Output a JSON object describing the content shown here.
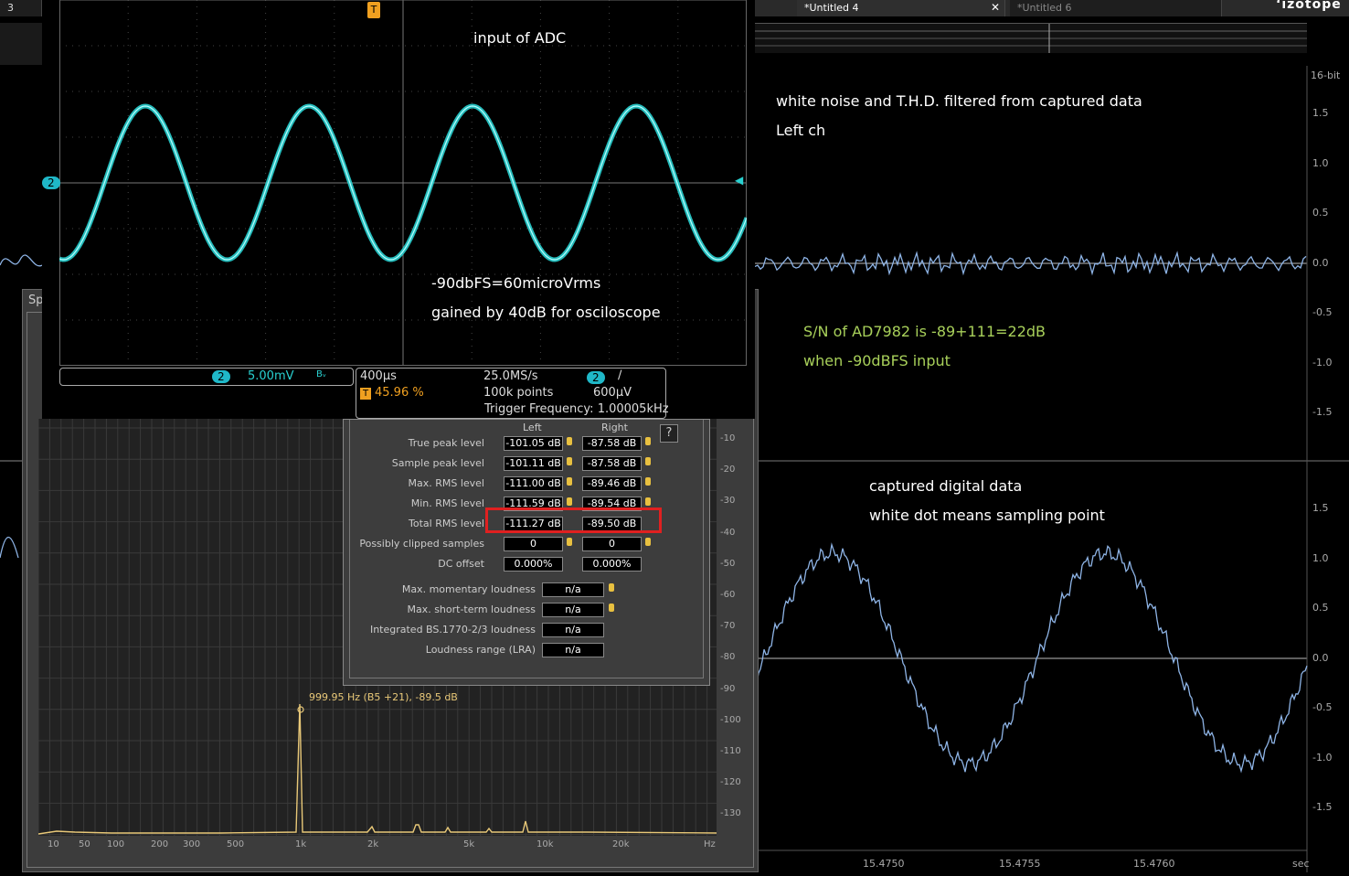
{
  "tabs": {
    "left_tab": "3",
    "active": "*Untitled 4",
    "close": "✕",
    "inactive": "*Untitled 6",
    "logo": "‘izotope"
  },
  "right_axis": {
    "top_label": "16-bit",
    "upper_ticks": [
      "1.5",
      "1.0",
      "0.5",
      "0.0",
      "-0.5",
      "-1.0",
      "-1.5"
    ],
    "lower_ticks": [
      "1.5",
      "1.0",
      "0.5",
      "0.0",
      "-0.5",
      "-1.0",
      "-1.5"
    ],
    "time_ticks": [
      "15.4750",
      "15.4755",
      "15.4760"
    ],
    "time_unit": "sec"
  },
  "annotations": {
    "upper_title": "white noise and T.H.D. filtered from captured data",
    "upper_sub": "Left ch",
    "sn_line1": "S/N of AD7982 is -89+111=22dB",
    "sn_line2": "when -90dBFS input",
    "lower_title": "captured digital data",
    "lower_sub": "white dot means sampling point",
    "scope_title": "input of ADC",
    "scope_note1": "-90dbFS=60microVrms",
    "scope_note2": "gained by 40dB for osciloscope"
  },
  "scope": {
    "channel": "2",
    "vdiv": "5.00mV",
    "bw_icon": "Bᵥ",
    "timebase": "400µs",
    "trigger_pos": "45.96 %",
    "sample_rate": "25.0MS/s",
    "points": "100k points",
    "trig_level": "600µV",
    "trig_freq": "Trigger Frequency: 1.00005kHz",
    "trig_marker": "T",
    "slope": "∕"
  },
  "stats": {
    "col_left": "Left",
    "col_right": "Right",
    "help": "?",
    "rows": [
      {
        "label": "True peak level",
        "left": "-101.05 dB",
        "right": "-87.58 dB",
        "pin": true
      },
      {
        "label": "Sample peak level",
        "left": "-101.11 dB",
        "right": "-87.58 dB",
        "pin": true
      },
      {
        "label": "Max. RMS level",
        "left": "-111.00 dB",
        "right": "-89.46 dB",
        "pin": true
      },
      {
        "label": "Min. RMS level",
        "left": "-111.59 dB",
        "right": "-89.54 dB",
        "pin": true
      },
      {
        "label": "Total RMS level",
        "left": "-111.27 dB",
        "right": "-89.50 dB",
        "pin": false
      },
      {
        "label": "Possibly clipped samples",
        "left": "0",
        "right": "0",
        "pin": true
      },
      {
        "label": "DC offset",
        "left": "0.000%",
        "right": "0.000%",
        "pin": false
      }
    ],
    "loudness": [
      {
        "label": "Max. momentary loudness",
        "value": "n/a",
        "pin": true
      },
      {
        "label": "Max. short-term loudness",
        "value": "n/a",
        "pin": true
      },
      {
        "label": "Integrated BS.1770-2/3 loudness",
        "value": "n/a",
        "pin": false
      },
      {
        "label": "Loudness range (LRA)",
        "value": "n/a",
        "pin": false
      }
    ]
  },
  "spectrum": {
    "title": "Sp",
    "peak_label": "999.95 Hz (B5 +21), -89.5 dB",
    "x_ticks": [
      "10",
      "50",
      "100",
      "200",
      "300",
      "500",
      "1k",
      "2k",
      "5k",
      "10k",
      "20k",
      "Hz"
    ],
    "y_ticks": [
      "-10",
      "-20",
      "-30",
      "-40",
      "-50",
      "-60",
      "-70",
      "-80",
      "-90",
      "-100",
      "-110",
      "-120",
      "-130"
    ],
    "colors": {
      "trace": "#e8c878",
      "accent": "#1fb8c8",
      "waveform": "#8eb4e6",
      "scope_trace": "#29d0d0"
    }
  }
}
